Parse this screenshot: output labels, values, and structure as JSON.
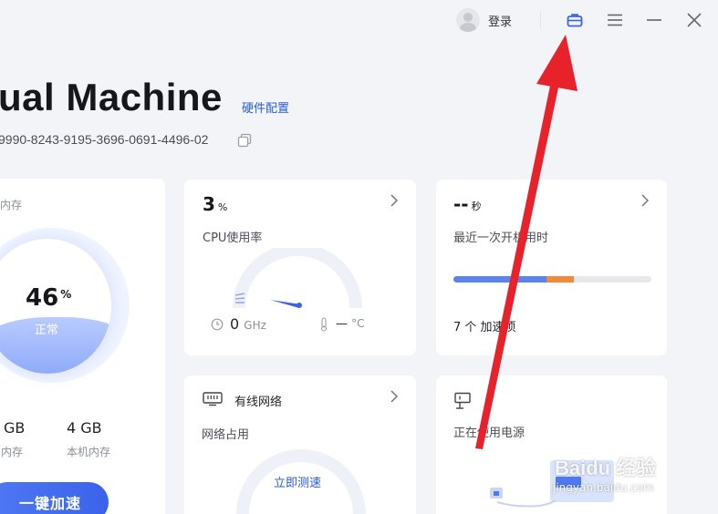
{
  "header": {
    "login_label": "登录"
  },
  "vm": {
    "title": "ual Machine",
    "hardware_link": "硬件配置",
    "machine_id": "9990-8243-9195-3696-0691-4496-02"
  },
  "memory": {
    "label": "内存",
    "usage_value": "46",
    "usage_unit": "%",
    "status": "正常",
    "used_value": "GB",
    "used_label": "内存",
    "local_value": "4 GB",
    "local_label": "本机内存",
    "boost_button": "一键加速",
    "usage_fraction": 0.46
  },
  "cpu": {
    "usage_value": "3",
    "usage_unit": "%",
    "label": "CPU使用率",
    "freq_value": "0",
    "freq_unit": "GHz",
    "temp_value": "—",
    "temp_unit": "°C"
  },
  "boot": {
    "time_value": "--",
    "time_unit": "秒",
    "label": "最近一次开机用时",
    "startup_items": "7 个 加速项",
    "bar_segments": [
      {
        "fraction": 0.47,
        "color": "#5b83ee"
      },
      {
        "fraction": 0.14,
        "color": "#f08a3c"
      },
      {
        "fraction": 0.39,
        "color": "#e6e8ec"
      }
    ]
  },
  "network": {
    "title": "有线网络",
    "label": "网络占用",
    "speed_test_link": "立即测速"
  },
  "power": {
    "label": "正在使用电源"
  },
  "watermark": {
    "logo_text": "Baidu 经验",
    "url_text": "jingyan.baidu.com"
  },
  "colors": {
    "accent": "#2a5bd7",
    "annotation_arrow": "#e8222a"
  }
}
